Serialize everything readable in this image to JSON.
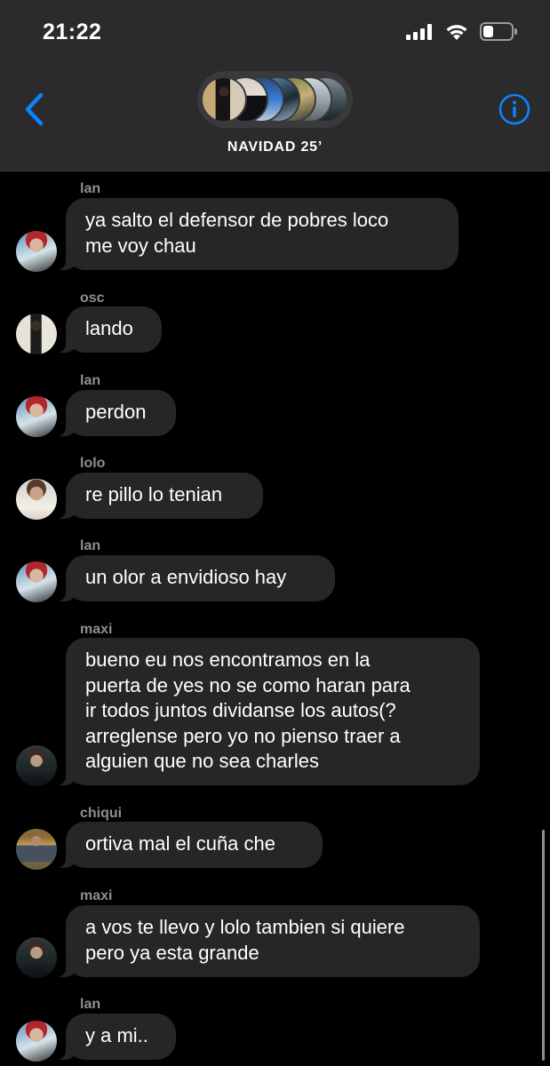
{
  "status_bar": {
    "time": "21:22",
    "battery_fraction": 0.35
  },
  "header": {
    "back_icon": "chevron-left-icon",
    "info_icon": "info-circle-icon",
    "group_name": "NAVIDAD 25’",
    "accent_color": "#0a84ff"
  },
  "messages": [
    {
      "sender": "lan",
      "text": "ya salto el defensor de pobres loco\nme voy chau",
      "avatar": "lan"
    },
    {
      "sender": "osc",
      "text": "lando",
      "avatar": "osc"
    },
    {
      "sender": "lan",
      "text": "perdon",
      "avatar": "lan"
    },
    {
      "sender": "lolo",
      "text": "re pillo lo tenian",
      "avatar": "lolo"
    },
    {
      "sender": "lan",
      "text": "un olor a envidioso hay",
      "avatar": "lan"
    },
    {
      "sender": "maxi",
      "text": "bueno eu nos encontramos en la\npuerta de yes no se como haran para\nir todos juntos dividanse los autos(?\narreglense pero yo no pienso traer a\nalguien que no sea charles",
      "avatar": "maxi"
    },
    {
      "sender": "chiqui",
      "text": "ortiva mal el cuña che",
      "avatar": "chiqui"
    },
    {
      "sender": "maxi",
      "text": " a vos te llevo y lolo tambien si quiere\npero ya esta grande",
      "avatar": "maxi"
    },
    {
      "sender": "lan",
      "text": "y a mi..",
      "avatar": "lan"
    }
  ]
}
